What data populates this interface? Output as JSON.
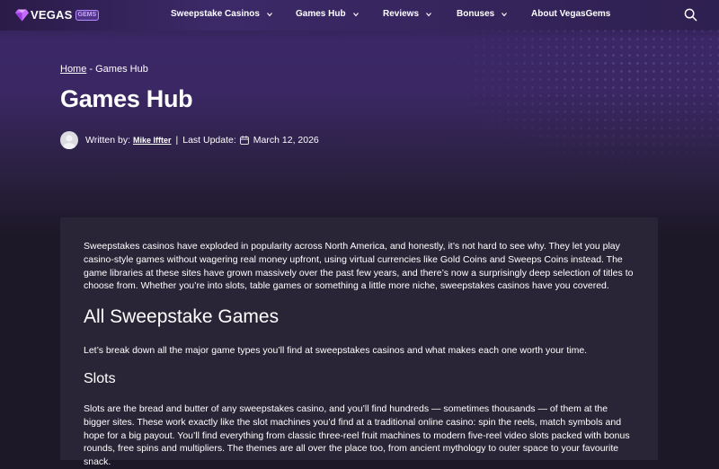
{
  "header": {
    "logo_text": "VEGAS",
    "logo_badge": "GEMS",
    "nav": [
      {
        "label": "Sweepstake Casinos",
        "has_dropdown": true
      },
      {
        "label": "Games Hub",
        "has_dropdown": true
      },
      {
        "label": "Reviews",
        "has_dropdown": true
      },
      {
        "label": "Bonuses",
        "has_dropdown": true
      },
      {
        "label": "About VegasGems",
        "has_dropdown": false
      }
    ],
    "search_icon": "search-icon"
  },
  "breadcrumb": {
    "home": "Home",
    "separator": " - ",
    "current": "Games Hub"
  },
  "page_title": "Games Hub",
  "byline": {
    "written_by_label": "Written by:",
    "author": "Mike Iffter",
    "separator": "|",
    "last_update_label": "Last Update:",
    "date": "March 12, 2026"
  },
  "article": {
    "intro": "Sweepstakes casinos have exploded in popularity across North America, and honestly, it’s not hard to see why. They let you play casino-style games without wagering real money upfront, using virtual currencies like Gold Coins and Sweeps Coins instead. The game libraries at these sites have grown massively over the past few years, and there’s now a surprisingly deep selection of titles to choose from. Whether you’re into slots, table games or something a little more niche, sweepstakes casinos have you covered.",
    "h2": "All Sweepstake Games",
    "lead": "Let’s break down all the major game types you’ll find at sweepstakes casinos and what makes each one worth your time.",
    "h3": "Slots",
    "slots_text": "Slots are the bread and butter of any sweepstakes casino, and you’ll find hundreds — sometimes thousands — of them at the bigger sites. These work exactly like the slot machines you’d find at a traditional online casino: spin the reels, match symbols and hope for a big payout. You’ll find everything from classic three-reel fruit machines to modern five-reel video slots packed with bonus rounds, free spins and multipliers. The themes are all over the place too, from ancient mythology to outer space to your favourite snack."
  },
  "colors": {
    "background": "#1d1828",
    "hero_purple": "#3b2766",
    "card": "#2a2536",
    "accent": "#b58cff"
  }
}
